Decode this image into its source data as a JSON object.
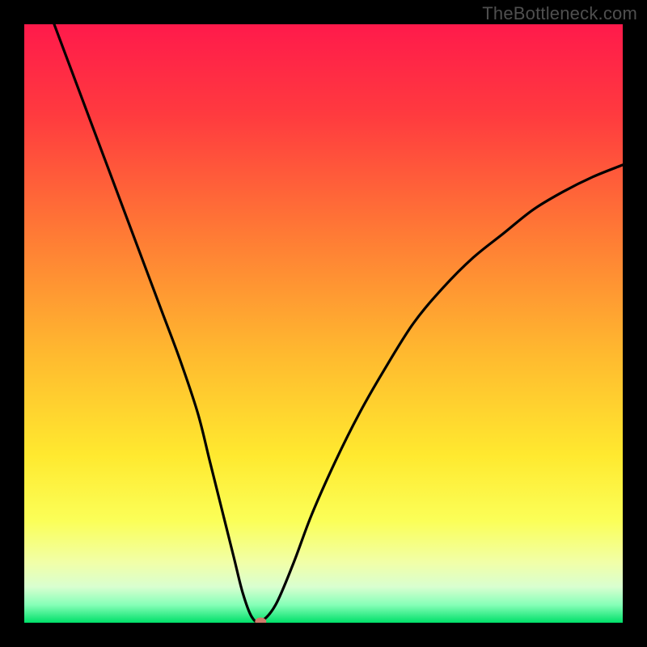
{
  "watermark": "TheBottleneck.com",
  "chart_data": {
    "type": "line",
    "title": "",
    "xlabel": "",
    "ylabel": "",
    "xlim": [
      0,
      100
    ],
    "ylim": [
      0,
      100
    ],
    "background_gradient_stops": [
      {
        "pos": 0.0,
        "color": "#ff1a4b"
      },
      {
        "pos": 0.15,
        "color": "#ff3a3f"
      },
      {
        "pos": 0.35,
        "color": "#ff7a35"
      },
      {
        "pos": 0.55,
        "color": "#ffb92f"
      },
      {
        "pos": 0.72,
        "color": "#ffe92f"
      },
      {
        "pos": 0.83,
        "color": "#fbff58"
      },
      {
        "pos": 0.9,
        "color": "#f1ffa8"
      },
      {
        "pos": 0.94,
        "color": "#d9ffd0"
      },
      {
        "pos": 0.97,
        "color": "#86ffb8"
      },
      {
        "pos": 1.0,
        "color": "#00e069"
      }
    ],
    "series": [
      {
        "name": "bottleneck-curve",
        "x": [
          5,
          8,
          11,
          14,
          17,
          20,
          23,
          26,
          29,
          31,
          33,
          35,
          36.5,
          38,
          39.5,
          42,
          45,
          48,
          52,
          56,
          60,
          65,
          70,
          75,
          80,
          85,
          90,
          95,
          100
        ],
        "y": [
          100,
          92,
          84,
          76,
          68,
          60,
          52,
          44,
          35,
          27,
          19,
          11,
          5,
          1,
          0.2,
          3,
          10,
          18,
          27,
          35,
          42,
          50,
          56,
          61,
          65,
          69,
          72,
          74.5,
          76.5
        ]
      }
    ],
    "marker": {
      "x": 39.5,
      "y": 0.2,
      "color": "#cf7a6a",
      "rx": 7,
      "ry": 5
    }
  }
}
